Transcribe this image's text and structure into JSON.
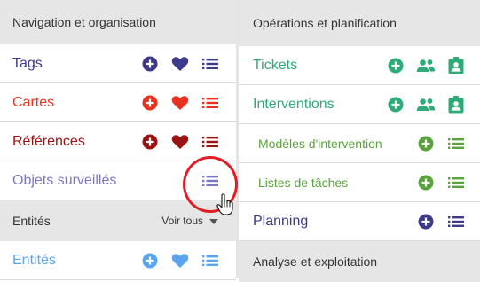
{
  "left_panel": {
    "navigation": {
      "title": "Navigation et organisation",
      "items": [
        {
          "label": "Tags",
          "color": "#3d3a8c",
          "actions": [
            "add-icon",
            "heart-icon",
            "list-icon"
          ]
        },
        {
          "label": "Cartes",
          "color": "#e8321f",
          "actions": [
            "add-icon",
            "heart-icon",
            "list-icon"
          ]
        },
        {
          "label": "Références",
          "color": "#9b1313",
          "actions": [
            "add-icon",
            "heart-icon",
            "list-icon"
          ]
        },
        {
          "label": "Objets surveillés",
          "color": "#7b78c2",
          "actions": [
            "list-icon"
          ]
        }
      ]
    },
    "entities": {
      "title": "Entités",
      "see_all": "Voir tous",
      "items": [
        {
          "label": "Entités",
          "color": "#5aa5ee",
          "actions": [
            "add-icon",
            "heart-icon",
            "list-icon"
          ]
        }
      ]
    }
  },
  "right_panel": {
    "operations": {
      "title": "Opérations et planification",
      "items": [
        {
          "label": "Tickets",
          "color": "#2fab79",
          "actions": [
            "add-icon",
            "people-icon",
            "contact-badge-icon"
          ]
        },
        {
          "label": "Interventions",
          "color": "#2fab79",
          "actions": [
            "add-icon",
            "people-icon",
            "contact-badge-icon"
          ]
        },
        {
          "label": "Modèles d'intervention",
          "color": "#5aa33c",
          "actions": [
            "add-icon",
            "list-icon"
          ]
        },
        {
          "label": "Listes de tâches",
          "color": "#5aa33c",
          "actions": [
            "add-icon",
            "list-icon"
          ]
        },
        {
          "label": "Planning",
          "color": "#3d3a8c",
          "actions": [
            "add-icon",
            "list-icon"
          ]
        }
      ]
    },
    "analysis": {
      "title": "Analyse et exploitation"
    }
  },
  "annotation": {
    "highlight_color": "#e31c25",
    "cursor": "hand-pointer-icon"
  }
}
